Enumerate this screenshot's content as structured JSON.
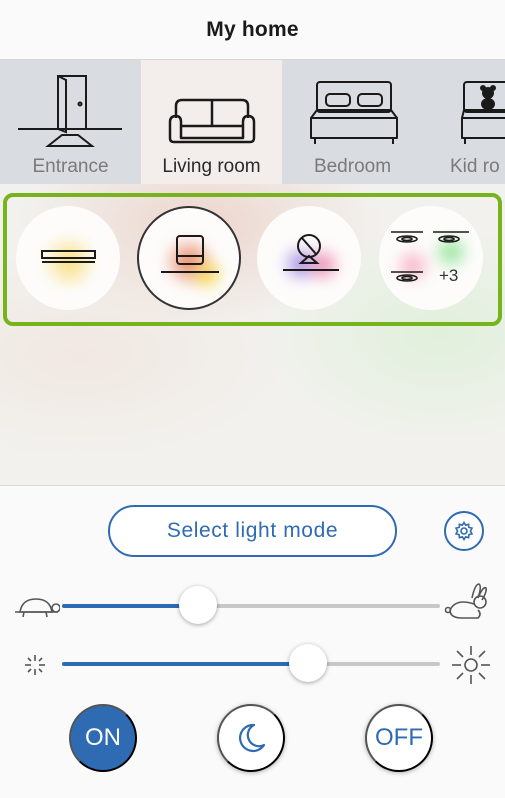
{
  "header": {
    "title": "My home"
  },
  "rooms": [
    {
      "label": "Entrance",
      "icon": "door-icon",
      "active": false
    },
    {
      "label": "Living room",
      "icon": "sofa-icon",
      "active": true
    },
    {
      "label": "Bedroom",
      "icon": "bed-icon",
      "active": false
    },
    {
      "label": "Kid ro",
      "icon": "teddy-bear-icon",
      "active": false
    }
  ],
  "scenes": [
    {
      "icon": "ceiling-light-icon",
      "selected": false
    },
    {
      "icon": "armchair-lamp-icon",
      "selected": true
    },
    {
      "icon": "vanity-mirror-icon",
      "selected": false
    },
    {
      "icon": "spotlights-group-icon",
      "selected": false,
      "extra": "+3"
    }
  ],
  "controls": {
    "mode_button": "Select light mode",
    "speed_slider": {
      "value_fraction": 0.36,
      "min_icon": "turtle-icon",
      "max_icon": "rabbit-icon"
    },
    "brightness_slider": {
      "value_fraction": 0.65,
      "min_icon": "dim-sun-icon",
      "max_icon": "bright-sun-icon"
    },
    "on_label": "ON",
    "off_label": "OFF"
  },
  "colors": {
    "accent": "#2f6bb3",
    "highlight": "#77b31d"
  }
}
